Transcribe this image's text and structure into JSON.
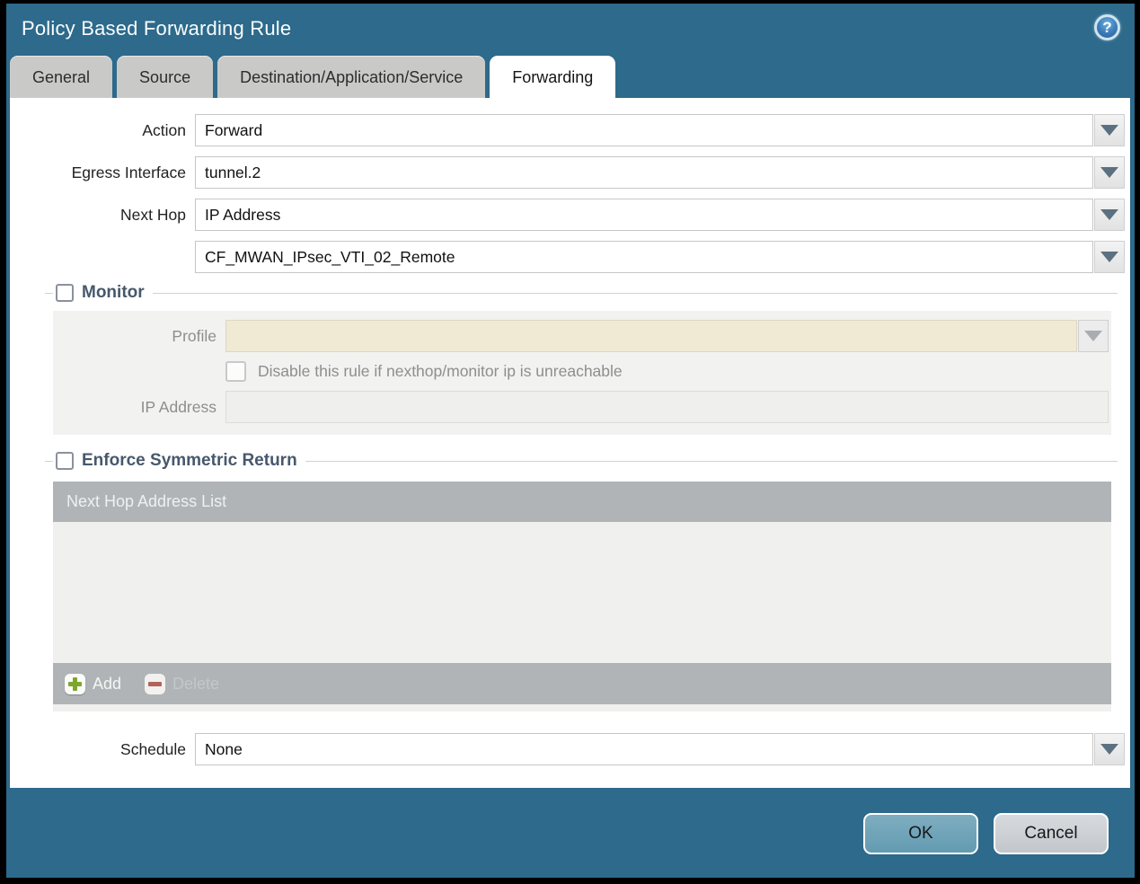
{
  "window": {
    "title": "Policy Based Forwarding Rule"
  },
  "help": {
    "glyph": "?"
  },
  "tabs": [
    {
      "label": "General",
      "active": false
    },
    {
      "label": "Source",
      "active": false
    },
    {
      "label": "Destination/Application/Service",
      "active": false
    },
    {
      "label": "Forwarding",
      "active": true
    }
  ],
  "form": {
    "action": {
      "label": "Action",
      "value": "Forward"
    },
    "egress_interface": {
      "label": "Egress Interface",
      "value": "tunnel.2"
    },
    "next_hop": {
      "label": "Next Hop",
      "value": "IP Address"
    },
    "next_hop_address": {
      "value": "CF_MWAN_IPsec_VTI_02_Remote"
    },
    "monitor": {
      "title": "Monitor",
      "checked": false,
      "profile": {
        "label": "Profile",
        "value": ""
      },
      "disable_rule": {
        "label": "Disable this rule if nexthop/monitor ip is unreachable",
        "checked": false
      },
      "ip_address": {
        "label": "IP Address",
        "value": ""
      }
    },
    "symmetric_return": {
      "title": "Enforce Symmetric Return",
      "checked": false,
      "table": {
        "header": "Next Hop Address List",
        "rows": []
      },
      "toolbar": {
        "add_label": "Add",
        "delete_label": "Delete"
      }
    },
    "schedule": {
      "label": "Schedule",
      "value": "None"
    }
  },
  "footer": {
    "ok_label": "OK",
    "cancel_label": "Cancel"
  },
  "colors": {
    "titlebar_teal": "#2d6a8b",
    "active_tab_bg": "#ffffff",
    "inactive_tab_bg": "#c9cac8",
    "disabled_field_beige": "#f0e9d4",
    "table_chrome_gray": "#b0b4b6",
    "ok_button_teal": "#6fa0b5",
    "cancel_button_gray": "#cdd0d3",
    "add_plus_green": "#7fa62c",
    "delete_minus_red": "#b2635a"
  }
}
